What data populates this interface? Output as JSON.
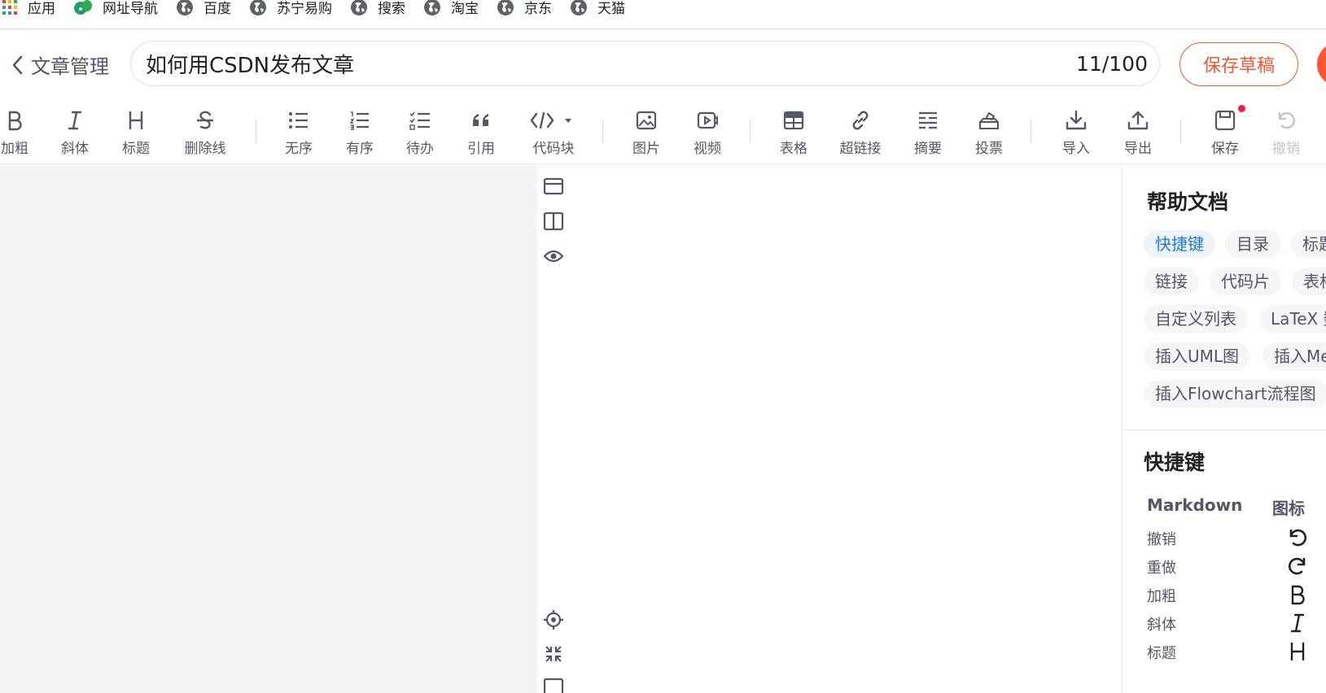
{
  "bookmarks": [
    {
      "label": "应用",
      "icon": "apps-grid-icon"
    },
    {
      "label": "网址导航",
      "icon": "leaf-icon"
    },
    {
      "label": "百度",
      "icon": "globe-icon"
    },
    {
      "label": "苏宁易购",
      "icon": "globe-icon"
    },
    {
      "label": "搜索",
      "icon": "globe-icon"
    },
    {
      "label": "淘宝",
      "icon": "globe-icon"
    },
    {
      "label": "京东",
      "icon": "globe-icon"
    },
    {
      "label": "天猫",
      "icon": "globe-icon"
    }
  ],
  "header": {
    "back_label": "文章管理",
    "title_value": "如何用CSDN发布文章",
    "char_count": "11/100",
    "save_draft_label": "保存草稿"
  },
  "toolbar": {
    "bold": "加粗",
    "italic": "斜体",
    "heading": "标题",
    "strike": "删除线",
    "unordered": "无序",
    "ordered": "有序",
    "todo": "待办",
    "quote": "引用",
    "codeblock": "代码块",
    "image": "图片",
    "video": "视频",
    "table": "表格",
    "link": "超链接",
    "summary": "摘要",
    "vote": "投票",
    "import": "导入",
    "export": "导出",
    "save": "保存",
    "undo": "撤销"
  },
  "help": {
    "title": "帮助文档",
    "tags": [
      "快捷键",
      "目录",
      "标题",
      "链接",
      "代码片",
      "表格",
      "自定义列表",
      "LaTeX 数学公式",
      "插入UML图",
      "插入Mermaid流程图",
      "插入Flowchart流程图"
    ],
    "shortcuts_title": "快捷键",
    "col_markdown": "Markdown",
    "col_icon": "图标",
    "rows": [
      {
        "name": "撤销",
        "icon": "undo-icon"
      },
      {
        "name": "重做",
        "icon": "redo-icon"
      },
      {
        "name": "加粗",
        "icon": "bold-icon"
      },
      {
        "name": "斜体",
        "icon": "italic-icon"
      },
      {
        "name": "标题",
        "icon": "heading-icon"
      }
    ]
  },
  "colors": {
    "accent": "#fc5531",
    "link_blue": "#1e7bd6",
    "text_gray": "#555666",
    "editor_bg": "#f4f4f4"
  }
}
